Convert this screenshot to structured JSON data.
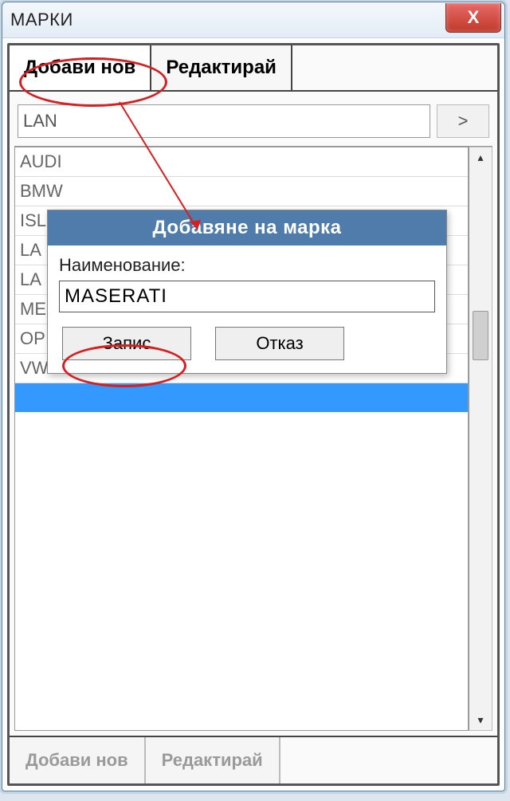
{
  "window": {
    "title": "МАРКИ"
  },
  "tabs": {
    "add": "Добави нов",
    "edit": "Редактирай"
  },
  "search": {
    "value": "LAN",
    "go_glyph": ">"
  },
  "list": {
    "items": [
      "AUDI",
      "BMW",
      "ISL",
      "LA",
      "LA",
      "ME",
      "OP",
      "VW"
    ],
    "selected_index": 8
  },
  "dialog": {
    "title": "Добавяне на марка",
    "label": "Наименование:",
    "value": "MASERATI",
    "save": "Запис",
    "cancel": "Отказ"
  },
  "footer": {
    "add": "Добави нов",
    "edit": "Редактирай"
  },
  "icons": {
    "close": "X",
    "up": "▴",
    "down": "▾"
  }
}
